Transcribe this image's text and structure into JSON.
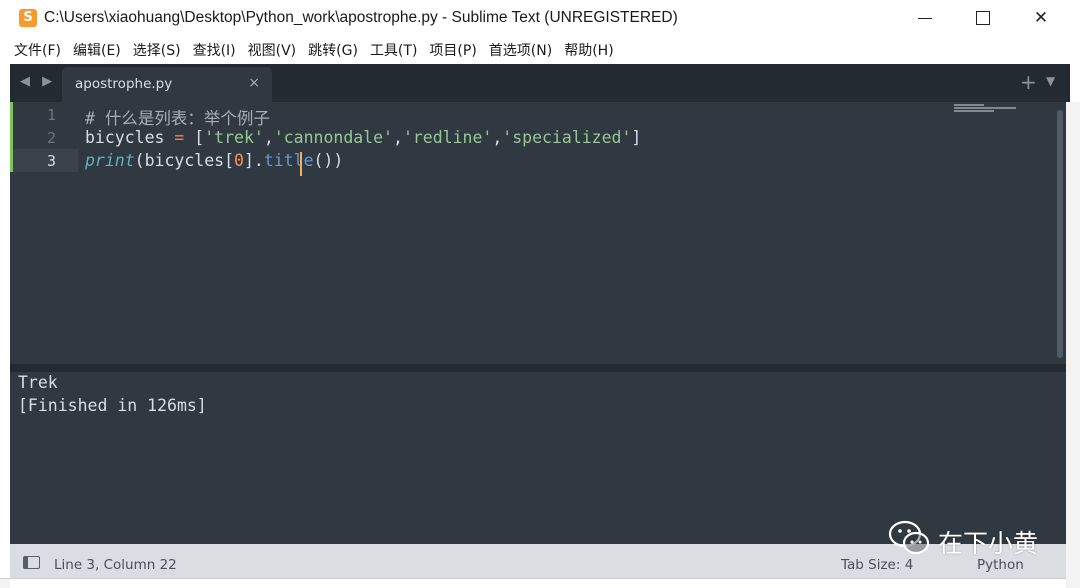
{
  "window": {
    "title": "C:\\Users\\xiaohuang\\Desktop\\Python_work\\apostrophe.py - Sublime Text (UNREGISTERED)",
    "app_icon": "sublime-text-icon",
    "min_label": "—",
    "max_label": "☐",
    "close_label": "✕"
  },
  "menu": {
    "items": [
      {
        "label": "文件(F)"
      },
      {
        "label": "编辑(E)"
      },
      {
        "label": "选择(S)"
      },
      {
        "label": "查找(I)"
      },
      {
        "label": "视图(V)"
      },
      {
        "label": "跳转(G)"
      },
      {
        "label": "工具(T)"
      },
      {
        "label": "项目(P)"
      },
      {
        "label": "首选项(N)"
      },
      {
        "label": "帮助(H)"
      }
    ]
  },
  "tabs": {
    "nav_arrows": "◀ ▶",
    "active": {
      "label": "apostrophe.py",
      "close": "×"
    },
    "plus": "+",
    "menu": "▼"
  },
  "editor": {
    "line_numbers": [
      "1",
      "2",
      "3"
    ],
    "active_line": 3,
    "lines": {
      "l1": "# 什么是列表：举个例子",
      "l2_var": "bicycles",
      "l2_eq": "=",
      "l2_open": "[",
      "l2_s1": "'trek'",
      "l2_c1": ",",
      "l2_s2": "'cannondale'",
      "l2_c2": ",",
      "l2_s3": "'redline'",
      "l2_c3": ",",
      "l2_s4": "'specialized'",
      "l2_close": "]",
      "l3_fn": "print",
      "l3_a": "(bicycles[",
      "l3_num": "0",
      "l3_b": "].",
      "l3_method": "title",
      "l3_c": "())"
    }
  },
  "output": {
    "lines": [
      "Trek",
      "[Finished in 126ms]"
    ]
  },
  "status": {
    "position": "Line 3, Column 22",
    "tab_size": "Tab Size: 4",
    "syntax": "Python"
  },
  "watermark": {
    "text": "在下小黄",
    "icon": "wechat-icon"
  },
  "colors": {
    "editor_bg": "#303841",
    "tabbar_bg": "#242a31",
    "string": "#99c794",
    "comment": "#a7adba",
    "keyword_op": "#f97b58",
    "function": "#5fb4b4",
    "method": "#6699cc",
    "number": "#f99157",
    "cursor": "#f9ae58",
    "statusbar_bg": "#dadde1"
  }
}
